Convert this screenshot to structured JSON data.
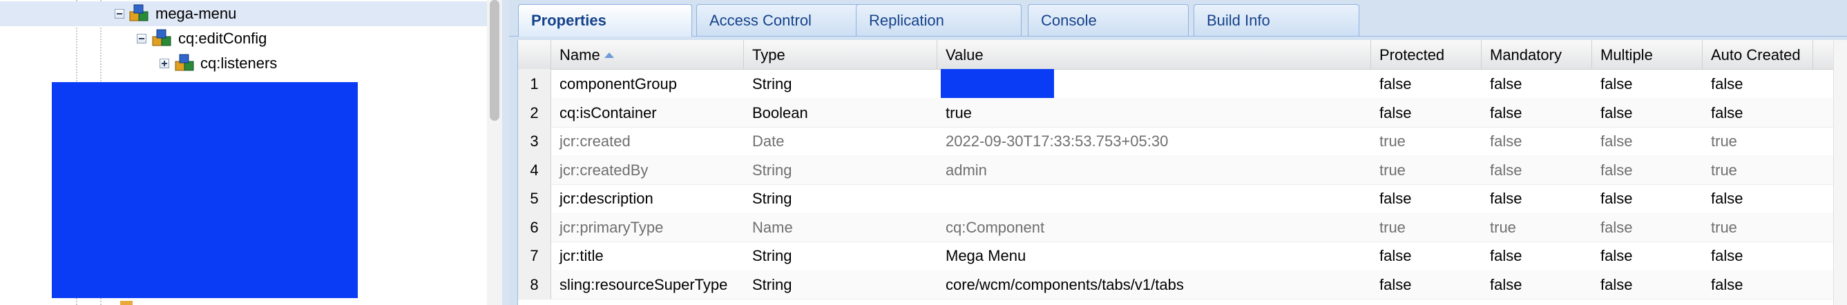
{
  "tree": {
    "nodes": [
      {
        "label": "mega-menu",
        "toggle": "minus",
        "selected": true
      },
      {
        "label": "cq:editConfig",
        "toggle": "minus",
        "selected": false
      },
      {
        "label": "cq:listeners",
        "toggle": "plus",
        "selected": false
      }
    ],
    "redaction_color": "#0a3cf5"
  },
  "tabs": [
    {
      "label": "Properties",
      "active": true
    },
    {
      "label": "Access Control",
      "active": false
    },
    {
      "label": "Replication",
      "active": false
    },
    {
      "label": "Console",
      "active": false
    },
    {
      "label": "Build Info",
      "active": false
    }
  ],
  "grid": {
    "columns": [
      "Name",
      "Type",
      "Value",
      "Protected",
      "Mandatory",
      "Multiple",
      "Auto Created"
    ],
    "sort": {
      "column": "Name",
      "direction": "ascending"
    },
    "rows": [
      {
        "num": "1",
        "name": "componentGroup",
        "type": "String",
        "value": "",
        "value_redacted": true,
        "protected": "false",
        "mandatory": "false",
        "multiple": "false",
        "auto": "false",
        "system": false
      },
      {
        "num": "2",
        "name": "cq:isContainer",
        "type": "Boolean",
        "value": "true",
        "protected": "false",
        "mandatory": "false",
        "multiple": "false",
        "auto": "false",
        "system": false
      },
      {
        "num": "3",
        "name": "jcr:created",
        "type": "Date",
        "value": "2022-09-30T17:33:53.753+05:30",
        "protected": "true",
        "mandatory": "false",
        "multiple": "false",
        "auto": "true",
        "system": true
      },
      {
        "num": "4",
        "name": "jcr:createdBy",
        "type": "String",
        "value": "admin",
        "protected": "true",
        "mandatory": "false",
        "multiple": "false",
        "auto": "true",
        "system": true
      },
      {
        "num": "5",
        "name": "jcr:description",
        "type": "String",
        "value": "",
        "protected": "false",
        "mandatory": "false",
        "multiple": "false",
        "auto": "false",
        "system": false
      },
      {
        "num": "6",
        "name": "jcr:primaryType",
        "type": "Name",
        "value": "cq:Component",
        "protected": "true",
        "mandatory": "true",
        "multiple": "false",
        "auto": "true",
        "system": true
      },
      {
        "num": "7",
        "name": "jcr:title",
        "type": "String",
        "value": "Mega Menu",
        "protected": "false",
        "mandatory": "false",
        "multiple": "false",
        "auto": "false",
        "system": false
      },
      {
        "num": "8",
        "name": "sling:resourceSuperType",
        "type": "String",
        "value": "core/wcm/components/tabs/v1/tabs",
        "protected": "false",
        "mandatory": "false",
        "multiple": "false",
        "auto": "false",
        "system": false
      }
    ]
  },
  "colors": {
    "accent": "#15428b",
    "tab_border": "#8db2e3",
    "selection": "#dfe8f6",
    "redaction": "#0a3cf5"
  }
}
